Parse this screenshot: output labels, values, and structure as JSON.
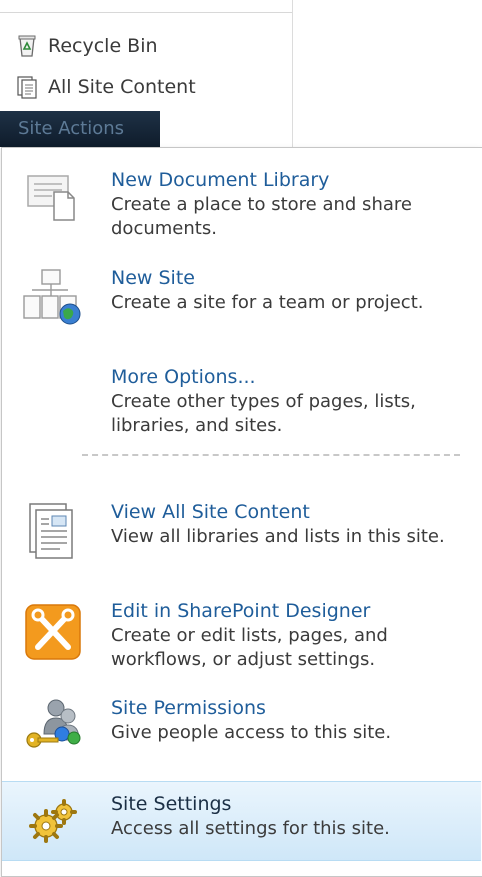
{
  "quick_launch": {
    "items": [
      {
        "label": "Recycle Bin",
        "icon": "recycle-bin-icon"
      },
      {
        "label": "All Site Content",
        "icon": "site-content-icon"
      }
    ]
  },
  "site_actions": {
    "label": "Site Actions"
  },
  "menu": {
    "items": [
      {
        "title": "New Document Library",
        "desc": "Create a place to store and share documents.",
        "icon": "document-library-icon"
      },
      {
        "title": "New Site",
        "desc": "Create a site for a team or project.",
        "icon": "new-site-icon"
      },
      {
        "title": "More Options...",
        "desc": "Create other types of pages, lists, libraries, and sites.",
        "icon": ""
      },
      {
        "title": "View All Site Content",
        "desc": "View all libraries and lists in this site.",
        "icon": "view-content-icon"
      },
      {
        "title": "Edit in SharePoint Designer",
        "desc": "Create or edit lists, pages, and workflows, or adjust settings.",
        "icon": "sharepoint-designer-icon"
      },
      {
        "title": "Site Permissions",
        "desc": "Give people access to this site.",
        "icon": "permissions-icon"
      },
      {
        "title": "Site Settings",
        "desc": "Access all settings for this site.",
        "icon": "settings-gears-icon"
      }
    ]
  },
  "colors": {
    "link": "#1f5d9a",
    "highlight": "#d6ebfa",
    "site_actions_bg": "#16263a"
  }
}
